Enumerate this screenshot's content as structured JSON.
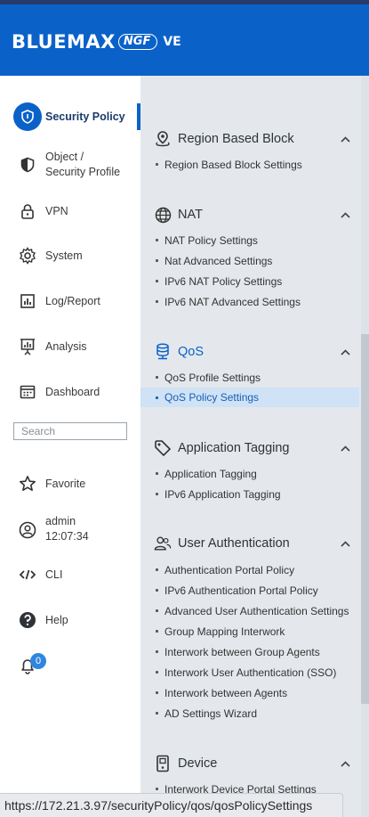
{
  "header": {
    "logo_main": "BLUEMAX",
    "logo_ngf": "NGF",
    "logo_ve": "VE"
  },
  "sidebar": {
    "items": [
      {
        "label": "Security Policy",
        "icon": "shield-icon",
        "active": true
      },
      {
        "label": "Object /\nSecurity Profile",
        "icon": "shield-half-icon"
      },
      {
        "label": "VPN",
        "icon": "lock-icon"
      },
      {
        "label": "System",
        "icon": "gear-icon"
      },
      {
        "label": "Log/Report",
        "icon": "bar-chart-icon"
      },
      {
        "label": "Analysis",
        "icon": "presentation-chart-icon"
      },
      {
        "label": "Dashboard",
        "icon": "dashboard-icon"
      }
    ],
    "search_placeholder": "Search",
    "favorite_label": "Favorite",
    "user": {
      "name": "admin",
      "time": "12:07:34"
    },
    "cli_label": "CLI",
    "help_label": "Help",
    "notification_count": "0"
  },
  "panel": {
    "sections": [
      {
        "title": "Region Based Block",
        "icon": "map-pin-icon",
        "items": [
          "Region Based Block Settings"
        ]
      },
      {
        "title": "NAT",
        "icon": "globe-icon",
        "items": [
          "NAT Policy Settings",
          "Nat Advanced Settings",
          "IPv6 NAT Policy Settings",
          "IPv6 NAT Advanced Settings"
        ]
      },
      {
        "title": "QoS",
        "icon": "database-icon",
        "items": [
          "QoS Profile Settings",
          "QoS Policy Settings"
        ],
        "selected_item": "QoS Policy Settings"
      },
      {
        "title": "Application Tagging",
        "icon": "tag-icon",
        "items": [
          "Application Tagging",
          "IPv6 Application Tagging"
        ]
      },
      {
        "title": "User Authentication",
        "icon": "users-icon",
        "items": [
          "Authentication Portal Policy",
          "IPv6 Authentication Portal Policy",
          "Advanced User Authentication Settings",
          "Group Mapping Interwork",
          "Interwork between Group Agents",
          "Interwork User Authentication (SSO)",
          "Interwork between Agents",
          "AD Settings Wizard"
        ]
      },
      {
        "title": "Device",
        "icon": "device-icon",
        "items": [
          "Interwork Device Portal Settings"
        ]
      }
    ]
  },
  "status_url": "https://172.21.3.97/securityPolicy/qos/qosPolicySettings",
  "colors": {
    "brand_blue": "#0a62c9",
    "panel_bg": "#e4e8ec",
    "selected_bg": "#cfe2f6"
  }
}
